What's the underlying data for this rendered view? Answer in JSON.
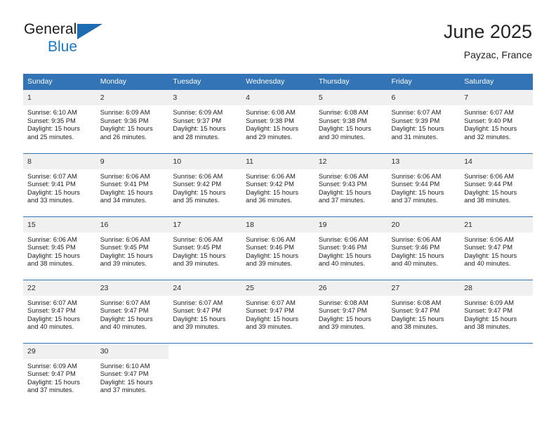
{
  "brand": {
    "name_top": "General",
    "name_bottom": "Blue",
    "triangle_color": "#1d6bb0",
    "blue_text_color": "#1878c6"
  },
  "header": {
    "title": "June 2025",
    "subtitle": "Payzac, France"
  },
  "colors": {
    "header_blue": "#3274b5",
    "daynum_band": "#f0f0f0",
    "row_divider": "#3274b5"
  },
  "calendar": {
    "weekday_headers": [
      "Sunday",
      "Monday",
      "Tuesday",
      "Wednesday",
      "Thursday",
      "Friday",
      "Saturday"
    ],
    "weeks": [
      [
        {
          "day": "1",
          "sunrise": "Sunrise: 6:10 AM",
          "sunset": "Sunset: 9:35 PM",
          "daylight_line1": "Daylight: 15 hours",
          "daylight_line2": "and 25 minutes."
        },
        {
          "day": "2",
          "sunrise": "Sunrise: 6:09 AM",
          "sunset": "Sunset: 9:36 PM",
          "daylight_line1": "Daylight: 15 hours",
          "daylight_line2": "and 26 minutes."
        },
        {
          "day": "3",
          "sunrise": "Sunrise: 6:09 AM",
          "sunset": "Sunset: 9:37 PM",
          "daylight_line1": "Daylight: 15 hours",
          "daylight_line2": "and 28 minutes."
        },
        {
          "day": "4",
          "sunrise": "Sunrise: 6:08 AM",
          "sunset": "Sunset: 9:38 PM",
          "daylight_line1": "Daylight: 15 hours",
          "daylight_line2": "and 29 minutes."
        },
        {
          "day": "5",
          "sunrise": "Sunrise: 6:08 AM",
          "sunset": "Sunset: 9:38 PM",
          "daylight_line1": "Daylight: 15 hours",
          "daylight_line2": "and 30 minutes."
        },
        {
          "day": "6",
          "sunrise": "Sunrise: 6:07 AM",
          "sunset": "Sunset: 9:39 PM",
          "daylight_line1": "Daylight: 15 hours",
          "daylight_line2": "and 31 minutes."
        },
        {
          "day": "7",
          "sunrise": "Sunrise: 6:07 AM",
          "sunset": "Sunset: 9:40 PM",
          "daylight_line1": "Daylight: 15 hours",
          "daylight_line2": "and 32 minutes."
        }
      ],
      [
        {
          "day": "8",
          "sunrise": "Sunrise: 6:07 AM",
          "sunset": "Sunset: 9:41 PM",
          "daylight_line1": "Daylight: 15 hours",
          "daylight_line2": "and 33 minutes."
        },
        {
          "day": "9",
          "sunrise": "Sunrise: 6:06 AM",
          "sunset": "Sunset: 9:41 PM",
          "daylight_line1": "Daylight: 15 hours",
          "daylight_line2": "and 34 minutes."
        },
        {
          "day": "10",
          "sunrise": "Sunrise: 6:06 AM",
          "sunset": "Sunset: 9:42 PM",
          "daylight_line1": "Daylight: 15 hours",
          "daylight_line2": "and 35 minutes."
        },
        {
          "day": "11",
          "sunrise": "Sunrise: 6:06 AM",
          "sunset": "Sunset: 9:42 PM",
          "daylight_line1": "Daylight: 15 hours",
          "daylight_line2": "and 36 minutes."
        },
        {
          "day": "12",
          "sunrise": "Sunrise: 6:06 AM",
          "sunset": "Sunset: 9:43 PM",
          "daylight_line1": "Daylight: 15 hours",
          "daylight_line2": "and 37 minutes."
        },
        {
          "day": "13",
          "sunrise": "Sunrise: 6:06 AM",
          "sunset": "Sunset: 9:44 PM",
          "daylight_line1": "Daylight: 15 hours",
          "daylight_line2": "and 37 minutes."
        },
        {
          "day": "14",
          "sunrise": "Sunrise: 6:06 AM",
          "sunset": "Sunset: 9:44 PM",
          "daylight_line1": "Daylight: 15 hours",
          "daylight_line2": "and 38 minutes."
        }
      ],
      [
        {
          "day": "15",
          "sunrise": "Sunrise: 6:06 AM",
          "sunset": "Sunset: 9:45 PM",
          "daylight_line1": "Daylight: 15 hours",
          "daylight_line2": "and 38 minutes."
        },
        {
          "day": "16",
          "sunrise": "Sunrise: 6:06 AM",
          "sunset": "Sunset: 9:45 PM",
          "daylight_line1": "Daylight: 15 hours",
          "daylight_line2": "and 39 minutes."
        },
        {
          "day": "17",
          "sunrise": "Sunrise: 6:06 AM",
          "sunset": "Sunset: 9:45 PM",
          "daylight_line1": "Daylight: 15 hours",
          "daylight_line2": "and 39 minutes."
        },
        {
          "day": "18",
          "sunrise": "Sunrise: 6:06 AM",
          "sunset": "Sunset: 9:46 PM",
          "daylight_line1": "Daylight: 15 hours",
          "daylight_line2": "and 39 minutes."
        },
        {
          "day": "19",
          "sunrise": "Sunrise: 6:06 AM",
          "sunset": "Sunset: 9:46 PM",
          "daylight_line1": "Daylight: 15 hours",
          "daylight_line2": "and 40 minutes."
        },
        {
          "day": "20",
          "sunrise": "Sunrise: 6:06 AM",
          "sunset": "Sunset: 9:46 PM",
          "daylight_line1": "Daylight: 15 hours",
          "daylight_line2": "and 40 minutes."
        },
        {
          "day": "21",
          "sunrise": "Sunrise: 6:06 AM",
          "sunset": "Sunset: 9:47 PM",
          "daylight_line1": "Daylight: 15 hours",
          "daylight_line2": "and 40 minutes."
        }
      ],
      [
        {
          "day": "22",
          "sunrise": "Sunrise: 6:07 AM",
          "sunset": "Sunset: 9:47 PM",
          "daylight_line1": "Daylight: 15 hours",
          "daylight_line2": "and 40 minutes."
        },
        {
          "day": "23",
          "sunrise": "Sunrise: 6:07 AM",
          "sunset": "Sunset: 9:47 PM",
          "daylight_line1": "Daylight: 15 hours",
          "daylight_line2": "and 40 minutes."
        },
        {
          "day": "24",
          "sunrise": "Sunrise: 6:07 AM",
          "sunset": "Sunset: 9:47 PM",
          "daylight_line1": "Daylight: 15 hours",
          "daylight_line2": "and 39 minutes."
        },
        {
          "day": "25",
          "sunrise": "Sunrise: 6:07 AM",
          "sunset": "Sunset: 9:47 PM",
          "daylight_line1": "Daylight: 15 hours",
          "daylight_line2": "and 39 minutes."
        },
        {
          "day": "26",
          "sunrise": "Sunrise: 6:08 AM",
          "sunset": "Sunset: 9:47 PM",
          "daylight_line1": "Daylight: 15 hours",
          "daylight_line2": "and 39 minutes."
        },
        {
          "day": "27",
          "sunrise": "Sunrise: 6:08 AM",
          "sunset": "Sunset: 9:47 PM",
          "daylight_line1": "Daylight: 15 hours",
          "daylight_line2": "and 38 minutes."
        },
        {
          "day": "28",
          "sunrise": "Sunrise: 6:09 AM",
          "sunset": "Sunset: 9:47 PM",
          "daylight_line1": "Daylight: 15 hours",
          "daylight_line2": "and 38 minutes."
        }
      ],
      [
        {
          "day": "29",
          "sunrise": "Sunrise: 6:09 AM",
          "sunset": "Sunset: 9:47 PM",
          "daylight_line1": "Daylight: 15 hours",
          "daylight_line2": "and 37 minutes."
        },
        {
          "day": "30",
          "sunrise": "Sunrise: 6:10 AM",
          "sunset": "Sunset: 9:47 PM",
          "daylight_line1": "Daylight: 15 hours",
          "daylight_line2": "and 37 minutes."
        },
        {
          "day": "",
          "sunrise": "",
          "sunset": "",
          "daylight_line1": "",
          "daylight_line2": ""
        },
        {
          "day": "",
          "sunrise": "",
          "sunset": "",
          "daylight_line1": "",
          "daylight_line2": ""
        },
        {
          "day": "",
          "sunrise": "",
          "sunset": "",
          "daylight_line1": "",
          "daylight_line2": ""
        },
        {
          "day": "",
          "sunrise": "",
          "sunset": "",
          "daylight_line1": "",
          "daylight_line2": ""
        },
        {
          "day": "",
          "sunrise": "",
          "sunset": "",
          "daylight_line1": "",
          "daylight_line2": ""
        }
      ]
    ]
  }
}
